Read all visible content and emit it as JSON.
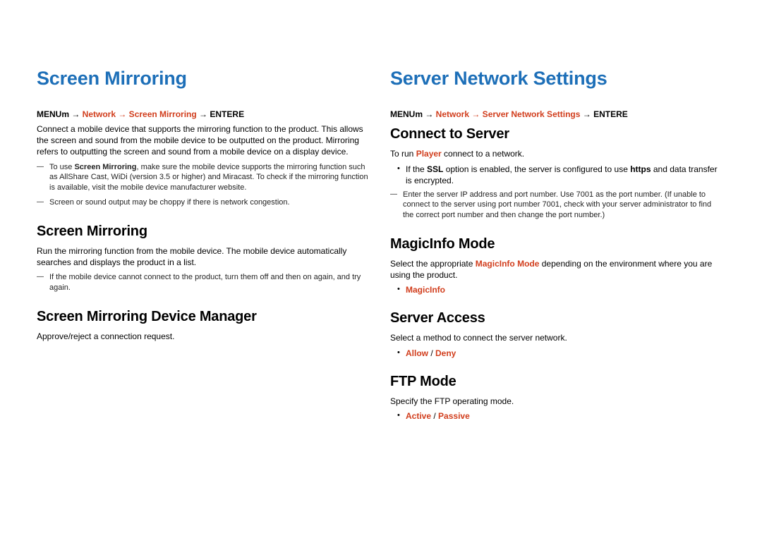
{
  "left": {
    "title": "Screen Mirroring",
    "breadcrumb": {
      "pre": "MENUm → ",
      "path": "Network → Screen Mirroring",
      "post": " → ENTER",
      "glyph": "E"
    },
    "intro": "Connect a mobile device that supports the mirroring function to the product. This allows the screen and sound from the mobile device to be outputted on the product. Mirroring refers to outputting the screen and sound from a mobile device on a display device.",
    "note1_pre": "To use ",
    "note1_b": "Screen Mirroring",
    "note1_post": ", make sure the mobile device supports the mirroring function such as AllShare Cast, WiDi (version 3.5 or higher) and Miracast. To check if the mirroring function is available, visit the mobile device manufacturer website.",
    "note2": "Screen or sound output may be choppy if there is network congestion.",
    "h2a": "Screen Mirroring",
    "p2a": "Run the mirroring function from the mobile device. The mobile device automatically searches and displays the product in a list.",
    "note3": "If the mobile device cannot connect to the product, turn them off and then on again, and try again.",
    "h2b": "Screen Mirroring Device Manager",
    "p2b": "Approve/reject a connection request."
  },
  "right": {
    "title": "Server Network Settings",
    "breadcrumb": {
      "pre": "MENUm → ",
      "path": "Network → Server Network Settings",
      "post": " → ENTER",
      "glyph": "E"
    },
    "h2a": "Connect to Server",
    "p_a_pre": "To run ",
    "p_a_hl": "Player",
    "p_a_post": " connect to a network.",
    "bullet1_pre": "If the ",
    "bullet1_b": "SSL",
    "bullet1_mid": " option is enabled, the server is configured to use ",
    "bullet1_b2": "https",
    "bullet1_post": " and data transfer is encrypted.",
    "note1": "Enter the server IP address and port number. Use 7001 as the port number. (If unable to connect to the server using port number 7001, check with your server administrator to find the correct port number and then change the port number.)",
    "h2b": "MagicInfo Mode",
    "p_b_pre": "Select the appropriate ",
    "p_b_hl": "MagicInfo Mode",
    "p_b_post": " depending on the environment where you are using the product.",
    "opt_b": "MagicInfo",
    "h2c": "Server Access",
    "p_c": "Select a method to connect the server network.",
    "opt_c1": "Allow",
    "opt_c_sep": " / ",
    "opt_c2": "Deny",
    "h2d": "FTP Mode",
    "p_d": "Specify the FTP operating mode.",
    "opt_d1": "Active",
    "opt_d_sep": " / ",
    "opt_d2": "Passive"
  }
}
